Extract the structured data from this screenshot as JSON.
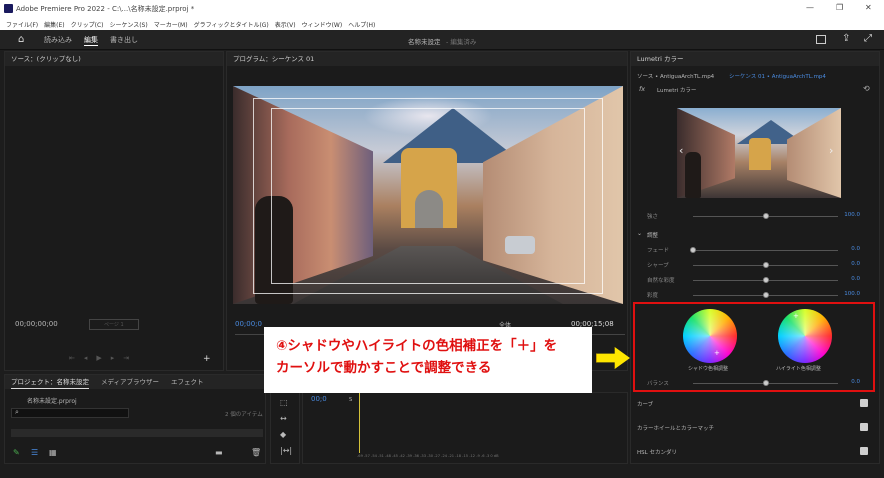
{
  "window": {
    "title": "Adobe Premiere Pro 2022 - C:\\...\\名称未設定.prproj *",
    "controls": [
      "—",
      "❐",
      "✕"
    ]
  },
  "menu": [
    "ファイル(F)",
    "編集(E)",
    "クリップ(C)",
    "シーケンス(S)",
    "マーカー(M)",
    "グラフィックとタイトル(G)",
    "表示(V)",
    "ウィンドウ(W)",
    "ヘルプ(H)"
  ],
  "workspace": {
    "tabs": [
      "読み込み",
      "編集",
      "書き出し"
    ],
    "active": "編集",
    "center_title": "名称未設定",
    "center_status": "- 編集済み"
  },
  "source_panel": {
    "title": "ソース：(クリップなし)",
    "timecode": "00;00;00;00",
    "page_label": "ページ 1"
  },
  "program_panel": {
    "title": "プログラム：シーケンス 01",
    "timecode_left": "00;00;0",
    "timecode_right": "00;00;15;08",
    "zoom": "全体"
  },
  "project_panel": {
    "tabs": [
      "プロジェクト：名称未設定",
      "メディアブラウザー",
      "エフェクト"
    ],
    "file": "名称未設定.prproj",
    "count": "2 個のアイテム"
  },
  "timeline": {
    "timecode": "00;0",
    "track_label": "S",
    "ruler": "-69  -57  -54  -51  -48  -45  -42  -39  -36  -33  -30  -27  -24  -21  -18  -15  -12  -9  -6  -3  0  dB"
  },
  "lumetri": {
    "title": "Lumetri カラー",
    "source_label": "ソース • AntiguaArchTL.mp4",
    "sequence_label": "シーケンス 01 • AntiguaArchTL.mp4",
    "fx_label": "Lumetri カラー",
    "sliders": [
      {
        "label": "強さ",
        "value": "100.0",
        "pos": 0.5
      },
      {
        "label": "フェード",
        "value": "0.0",
        "pos": 0.0
      },
      {
        "label": "シャープ",
        "value": "0.0",
        "pos": 0.5
      },
      {
        "label": "自然な彩度",
        "value": "0.0",
        "pos": 0.5
      },
      {
        "label": "彩度",
        "value": "100.0",
        "pos": 0.5
      }
    ],
    "section_adjust": "調整",
    "wheels": {
      "shadow_label": "シャドウ色相調整",
      "highlight_label": "ハイライト色相調整"
    },
    "balance": {
      "label": "バランス",
      "value": "0.0",
      "pos": 0.5
    },
    "sections": [
      "カーブ",
      "カラーホイールとカラーマッチ",
      "HSL セカンダリ"
    ]
  },
  "annotation": {
    "line1": "④シャドウやハイライトの色相補正を「＋」を",
    "line2": "カーソルで動かすことで調整できる",
    "border_color": "#e01010",
    "arrow_color": "#ffe600"
  }
}
